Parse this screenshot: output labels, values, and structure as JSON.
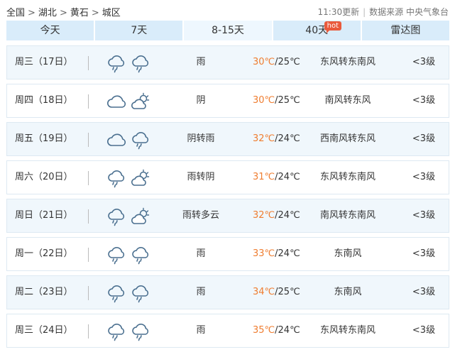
{
  "breadcrumb": [
    "全国",
    "湖北",
    "黄石",
    "城区"
  ],
  "breadcrumb_sep": ">",
  "updated": "11:30更新",
  "source": "数据来源 中央气象台",
  "tabs": [
    {
      "label": "今天",
      "active": false
    },
    {
      "label": "7天",
      "active": false
    },
    {
      "label": "8-15天",
      "active": true
    },
    {
      "label": "40天",
      "active": false,
      "badge": "hot"
    },
    {
      "label": "雷达图",
      "active": false
    }
  ],
  "colors": {
    "tab_bg": "#d9ecfa",
    "tab_active_bg": "#eef7fe",
    "high_temp": "#ef7d30",
    "badge": "#e95a3c",
    "row_bg": "#f0f7fc"
  },
  "forecast": [
    {
      "day": "周三（17日）",
      "icons": [
        "rain-icon",
        "rain-icon"
      ],
      "condition": "雨",
      "high": "30℃",
      "low": "/25℃",
      "wind": "东风转东南风",
      "level": "<3级"
    },
    {
      "day": "周四（18日）",
      "icons": [
        "overcast-icon",
        "partly-cloudy-icon"
      ],
      "condition": "阴",
      "high": "30℃",
      "low": "/25℃",
      "wind": "南风转东风",
      "level": "<3级"
    },
    {
      "day": "周五（19日）",
      "icons": [
        "overcast-icon",
        "rain-icon"
      ],
      "condition": "阴转雨",
      "high": "32℃",
      "low": "/24℃",
      "wind": "西南风转东风",
      "level": "<3级"
    },
    {
      "day": "周六（20日）",
      "icons": [
        "rain-icon",
        "partly-cloudy-icon"
      ],
      "condition": "雨转阴",
      "high": "31℃",
      "low": "/24℃",
      "wind": "东风转东南风",
      "level": "<3级"
    },
    {
      "day": "周日（21日）",
      "icons": [
        "rain-icon",
        "partly-cloudy-icon"
      ],
      "condition": "雨转多云",
      "high": "32℃",
      "low": "/24℃",
      "wind": "南风转东南风",
      "level": "<3级"
    },
    {
      "day": "周一（22日）",
      "icons": [
        "rain-icon",
        "rain-icon"
      ],
      "condition": "雨",
      "high": "33℃",
      "low": "/24℃",
      "wind": "东南风",
      "level": "<3级"
    },
    {
      "day": "周二（23日）",
      "icons": [
        "rain-icon",
        "rain-icon"
      ],
      "condition": "雨",
      "high": "34℃",
      "low": "/25℃",
      "wind": "东南风",
      "level": "<3级"
    },
    {
      "day": "周三（24日）",
      "icons": [
        "rain-icon",
        "rain-icon"
      ],
      "condition": "雨",
      "high": "35℃",
      "low": "/24℃",
      "wind": "东风转东南风",
      "level": "<3级"
    }
  ]
}
